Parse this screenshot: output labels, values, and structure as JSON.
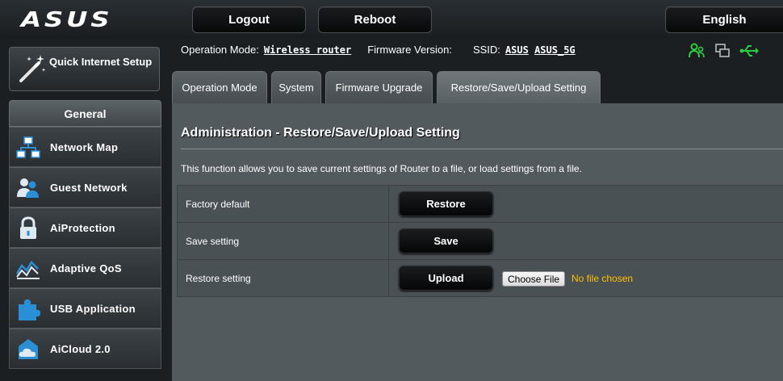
{
  "header": {
    "logo": "ASUS",
    "logout_label": "Logout",
    "reboot_label": "Reboot",
    "language_label": "English"
  },
  "status": {
    "op_mode_label": "Operation Mode:",
    "op_mode_value": "Wireless router",
    "firmware_label": "Firmware Version:",
    "ssid_label": "SSID:",
    "ssid_1": "ASUS",
    "ssid_2": "ASUS_5G"
  },
  "sidebar": {
    "qis_label": "Quick Internet Setup",
    "section_title": "General",
    "items": [
      {
        "label": "Network Map",
        "icon": "network-map-icon"
      },
      {
        "label": "Guest Network",
        "icon": "guest-network-icon"
      },
      {
        "label": "AiProtection",
        "icon": "lock-icon"
      },
      {
        "label": "Adaptive QoS",
        "icon": "qos-chart-icon"
      },
      {
        "label": "USB Application",
        "icon": "puzzle-icon"
      },
      {
        "label": "AiCloud 2.0",
        "icon": "cloud-icon"
      }
    ]
  },
  "tabs": [
    {
      "label": "Operation Mode"
    },
    {
      "label": "System"
    },
    {
      "label": "Firmware Upgrade"
    },
    {
      "label": "Restore/Save/Upload Setting",
      "active": true
    }
  ],
  "panel": {
    "title": "Administration - Restore/Save/Upload Setting",
    "description": "This function allows you to save current settings of Router to a file, or load settings from a file.",
    "rows": [
      {
        "label": "Factory default",
        "button": "Restore"
      },
      {
        "label": "Save setting",
        "button": "Save"
      },
      {
        "label": "Restore setting",
        "button": "Upload",
        "file_button": "Choose File",
        "file_status": "No file chosen"
      }
    ]
  },
  "colors": {
    "accent_green": "#2ecc40",
    "file_status": "#ffc000",
    "panel_bg": "#535a5e"
  }
}
